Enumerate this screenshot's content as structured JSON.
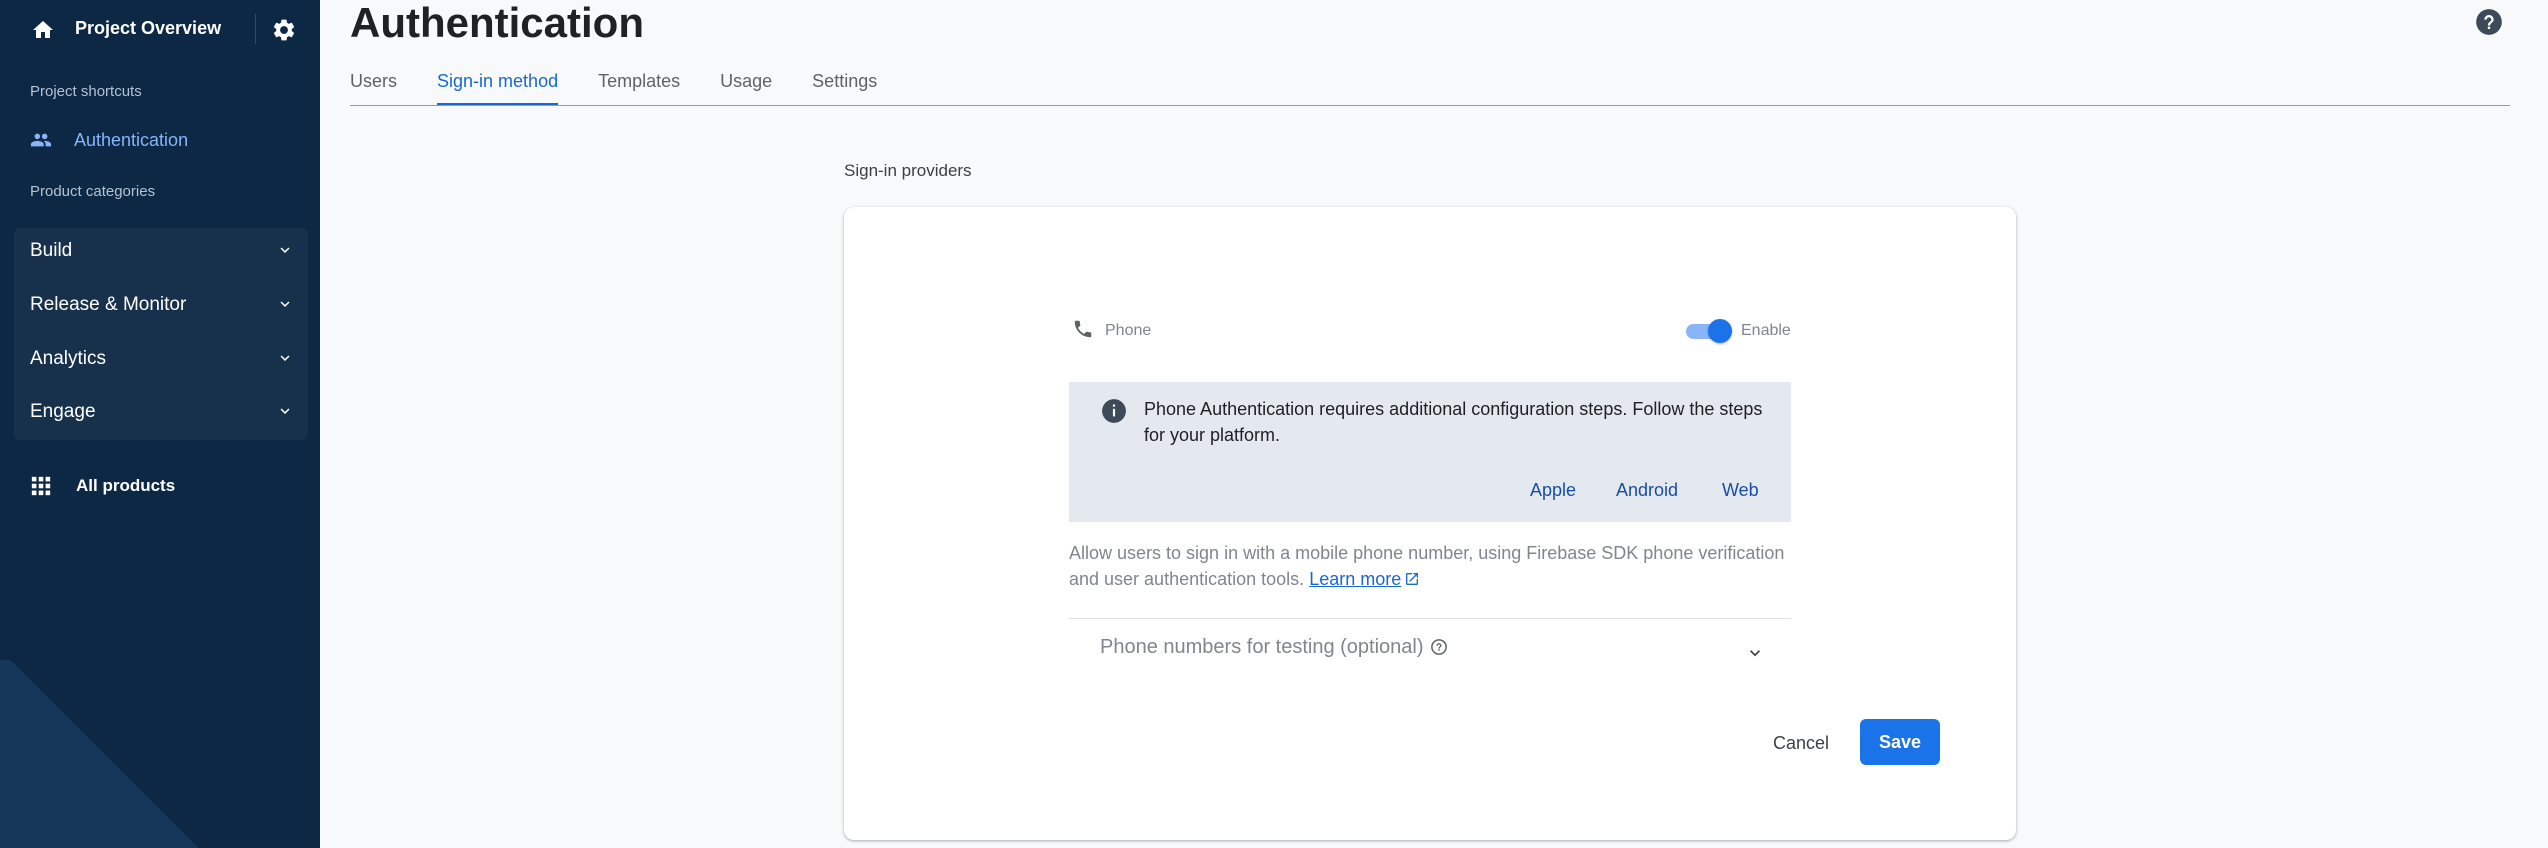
{
  "sidebar": {
    "project_overview": "Project Overview",
    "shortcuts_heading": "Project shortcuts",
    "shortcut_auth": "Authentication",
    "categories_heading": "Product categories",
    "categories": [
      "Build",
      "Release & Monitor",
      "Analytics",
      "Engage"
    ],
    "all_products": "All products"
  },
  "header": {
    "title": "Authentication",
    "tabs": [
      "Users",
      "Sign-in method",
      "Templates",
      "Usage",
      "Settings"
    ],
    "active_tab": "Sign-in method"
  },
  "main": {
    "section_label": "Sign-in providers",
    "provider": "Phone",
    "enable_label": "Enable",
    "enabled": true,
    "info_text": "Phone Authentication requires additional configuration steps. Follow the steps for your platform.",
    "platforms": [
      "Apple",
      "Android",
      "Web"
    ],
    "description": "Allow users to sign in with a mobile phone number, using Firebase SDK phone verification and user authentication tools.",
    "learn_more": "Learn more",
    "testing_label": "Phone numbers for testing (optional)",
    "cancel": "Cancel",
    "save": "Save"
  },
  "colors": {
    "sidebar_bg": "#0c2845",
    "accent": "#1a73e8",
    "link": "#174ea6",
    "shortcut_active": "#8ab4f8"
  },
  "icons": [
    "home-icon",
    "gear-icon",
    "people-icon",
    "chevron-down-icon",
    "grid-icon",
    "help-icon",
    "phone-icon",
    "info-icon",
    "external-link-icon",
    "question-icon"
  ]
}
